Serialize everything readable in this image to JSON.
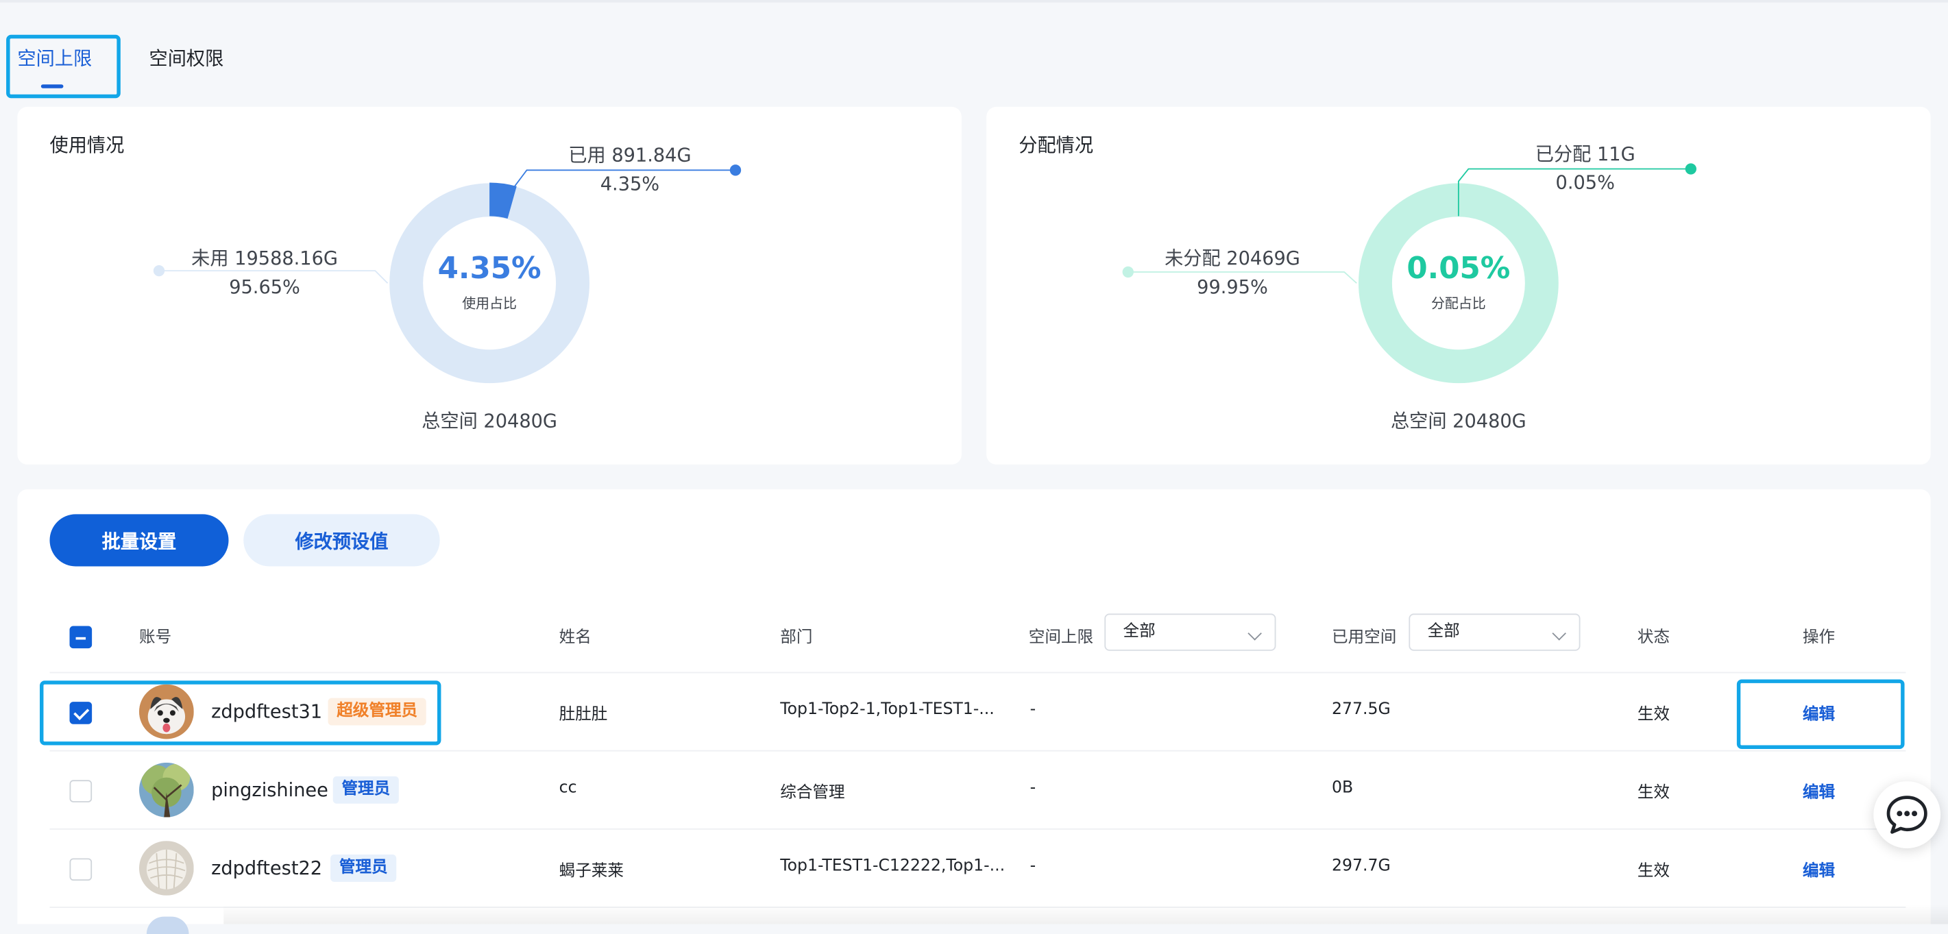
{
  "tabs": [
    {
      "label": "空间上限",
      "active": true
    },
    {
      "label": "空间权限",
      "active": false
    }
  ],
  "usage_card": {
    "title": "使用情况",
    "used_label": "已用 891.84G",
    "used_pct": "4.35%",
    "unused_label": "未用 19588.16G",
    "unused_pct": "95.65%",
    "center_value": "4.35%",
    "center_caption": "使用占比",
    "total": "总空间 20480G",
    "used_fraction": 0.0435,
    "colors": {
      "used": "#3a7de0",
      "unused": "#dbe8f7"
    }
  },
  "alloc_card": {
    "title": "分配情况",
    "alloc_label": "已分配 11G",
    "alloc_pct": "0.05%",
    "unalloc_label": "未分配 20469G",
    "unalloc_pct": "99.95%",
    "center_value": "0.05%",
    "center_caption": "分配占比",
    "total": "总空间 20480G",
    "alloc_fraction": 0.0005,
    "colors": {
      "alloc": "#1ec9a0",
      "unalloc": "#c2f2e4"
    }
  },
  "actions": {
    "batch_label": "批量设置",
    "preset_label": "修改预设值"
  },
  "table": {
    "headers": {
      "account": "账号",
      "name": "姓名",
      "dept": "部门",
      "quota": "空间上限",
      "used": "已用空间",
      "status": "状态",
      "ops": "操作"
    },
    "quota_filter": "全部",
    "used_filter": "全部",
    "rows": [
      {
        "account": "zdpdftest31",
        "role": "超级管理员",
        "name": "肚肚肚",
        "dept": "Top1-Top2-1,Top1-TEST1-...",
        "quota": "-",
        "used": "277.5G",
        "status": "生效",
        "op": "编辑",
        "checked": true
      },
      {
        "account": "pingzishinee",
        "role": "管理员",
        "name": "cc",
        "dept": "综合管理",
        "quota": "-",
        "used": "0B",
        "status": "生效",
        "op": "编辑",
        "checked": false
      },
      {
        "account": "zdpdftest22",
        "role": "管理员",
        "name": "蝎子莱莱",
        "dept": "Top1-TEST1-C12222,Top1-...",
        "quota": "-",
        "used": "297.7G",
        "status": "生效",
        "op": "编辑",
        "checked": false
      }
    ]
  },
  "icons": {
    "chat": "chat-bubble-icon",
    "chevron": "chevron-down-icon",
    "check": "check-icon"
  }
}
